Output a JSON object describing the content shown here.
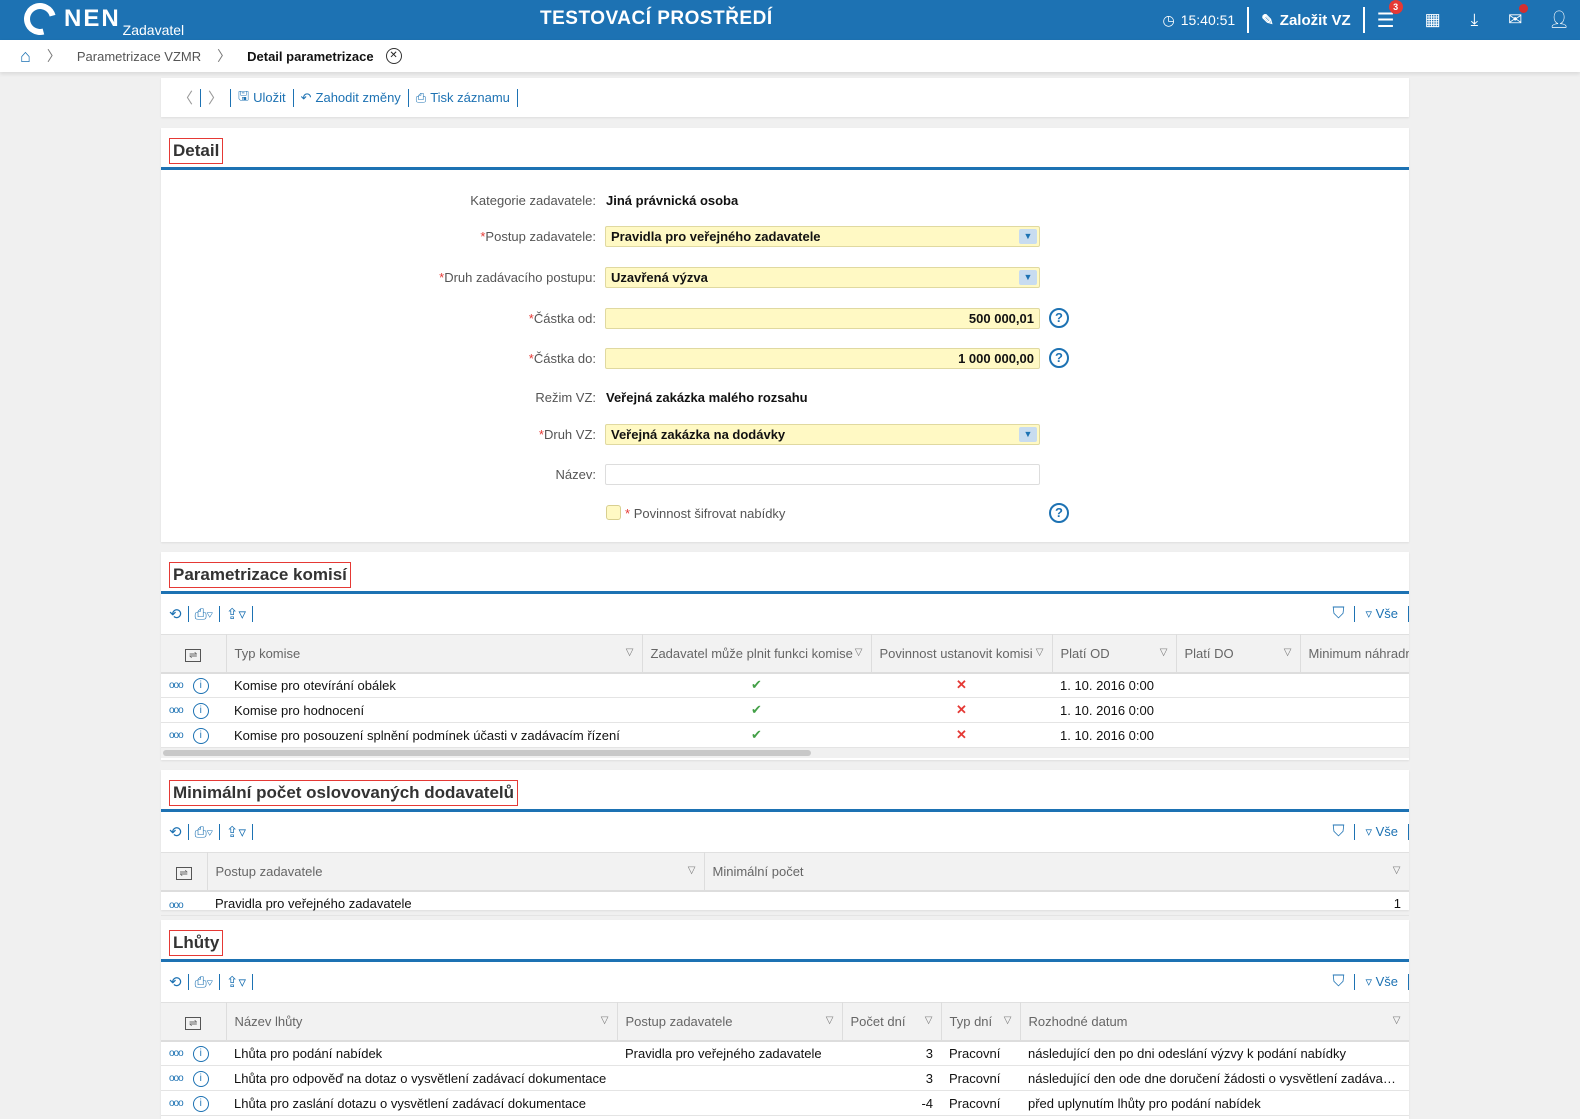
{
  "header": {
    "logo": "NEN",
    "logo_sub": "Zadavatel",
    "environment": "TESTOVACÍ PROSTŘEDÍ",
    "time": "15:40:51",
    "create_label": "Založit VZ",
    "menu_badge": "3",
    "accent": "#1d72b3"
  },
  "breadcrumb": {
    "items": [
      "Parametrizace VZMR",
      "Detail parametrizace"
    ]
  },
  "actions": {
    "save": "Uložit",
    "discard": "Zahodit změny",
    "print": "Tisk záznamu"
  },
  "detail": {
    "title": "Detail",
    "fields": [
      {
        "label": "Kategorie zadavatele:",
        "value": "Jiná právnická osoba",
        "required": false
      },
      {
        "label": "Postup zadavatele:",
        "value": "Pravidla pro veřejného zadavatele",
        "required": true
      },
      {
        "label": "Druh zadávacího postupu:",
        "value": "Uzavřená výzva",
        "required": true
      },
      {
        "label": "Částka od:",
        "value": "500 000,01",
        "required": true
      },
      {
        "label": "Částka do:",
        "value": "1 000 000,00",
        "required": true
      },
      {
        "label": "Režim VZ:",
        "value": "Veřejná zakázka malého rozsahu",
        "required": false
      },
      {
        "label": "Druh VZ:",
        "value": "Veřejná zakázka na dodávky",
        "required": true
      },
      {
        "label": "Název:",
        "value": "",
        "required": false
      }
    ],
    "checkbox_label": "Povinnost šifrovat nabídky",
    "checkbox_checked": false
  },
  "grid_all_label": "Vše",
  "komise": {
    "title": "Parametrizace komisí",
    "columns": [
      "Typ komise",
      "Zadavatel může plnit funkci komise",
      "Povinnost ustanovit komisi",
      "Platí OD",
      "Platí DO",
      "Minimum náhradníků"
    ],
    "rows": [
      [
        "Komise pro otevírání obálek",
        "check",
        "cross",
        "1. 10. 2016 0:00",
        "",
        ""
      ],
      [
        "Komise pro hodnocení",
        "check",
        "cross",
        "1. 10. 2016 0:00",
        "",
        ""
      ],
      [
        "Komise pro posouzení splnění podmínek účasti v zadávacím řízení",
        "check",
        "cross",
        "1. 10. 2016 0:00",
        "",
        ""
      ]
    ]
  },
  "minimalni": {
    "title": "Minimální počet oslovovaných dodavatelů",
    "columns": [
      "Postup zadavatele",
      "Minimální počet"
    ],
    "rows": [
      [
        "Pravidla pro veřejného zadavatele",
        "1"
      ]
    ]
  },
  "lhuty": {
    "title": "Lhůty",
    "columns": [
      "Název lhůty",
      "Postup zadavatele",
      "Počet dní",
      "Typ dní",
      "Rozhodné datum"
    ],
    "rows": [
      [
        "Lhůta pro podání nabídek",
        "Pravidla pro veřejného zadavatele",
        "3",
        "Pracovní",
        "následující den po dni odeslání výzvy k podání nabídky"
      ],
      [
        "Lhůta pro odpověď na dotaz o vysvětlení zadávací dokumentace",
        "",
        "3",
        "Pracovní",
        "následující den ode dne doručení žádosti o vysvětlení zadávací dokumentace"
      ],
      [
        "Lhůta pro zaslání dotazu o vysvětlení zadávací dokumentace",
        "",
        "-4",
        "Pracovní",
        "před uplynutím lhůty pro podání nabídek"
      ]
    ]
  }
}
